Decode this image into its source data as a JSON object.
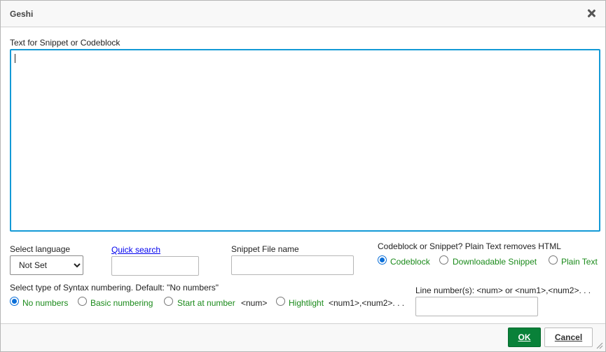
{
  "dialog": {
    "title": "Geshi"
  },
  "snippet": {
    "label": "Text for Snippet or Codeblock",
    "value": ""
  },
  "language": {
    "label": "Select language",
    "selected": "Not Set"
  },
  "quick_search": {
    "label": "Quick search",
    "value": ""
  },
  "filename": {
    "label": "Snippet File name",
    "value": ""
  },
  "mode": {
    "label": "Codeblock or Snippet? Plain Text removes HTML",
    "options": [
      "Codeblock",
      "Downloadable Snippet",
      "Plain Text"
    ],
    "selected": "Codeblock"
  },
  "numbering": {
    "label": "Select type of Syntax numbering. Default: \"No numbers\"",
    "options": [
      {
        "label": "No numbers",
        "suffix": ""
      },
      {
        "label": "Basic numbering",
        "suffix": ""
      },
      {
        "label": "Start at number",
        "suffix": "<num>"
      },
      {
        "label": "Hightlight",
        "suffix": "<num1>,<num2>. . ."
      }
    ],
    "selected": "No numbers"
  },
  "line_numbers": {
    "label": "Line number(s): <num> or <num1>,<num2>. . .",
    "value": ""
  },
  "footer": {
    "ok_label": "OK",
    "cancel_label": "Cancel"
  },
  "colors": {
    "accent": "#139ad6",
    "ok": "#098139",
    "option_text": "#1a8a1a"
  }
}
